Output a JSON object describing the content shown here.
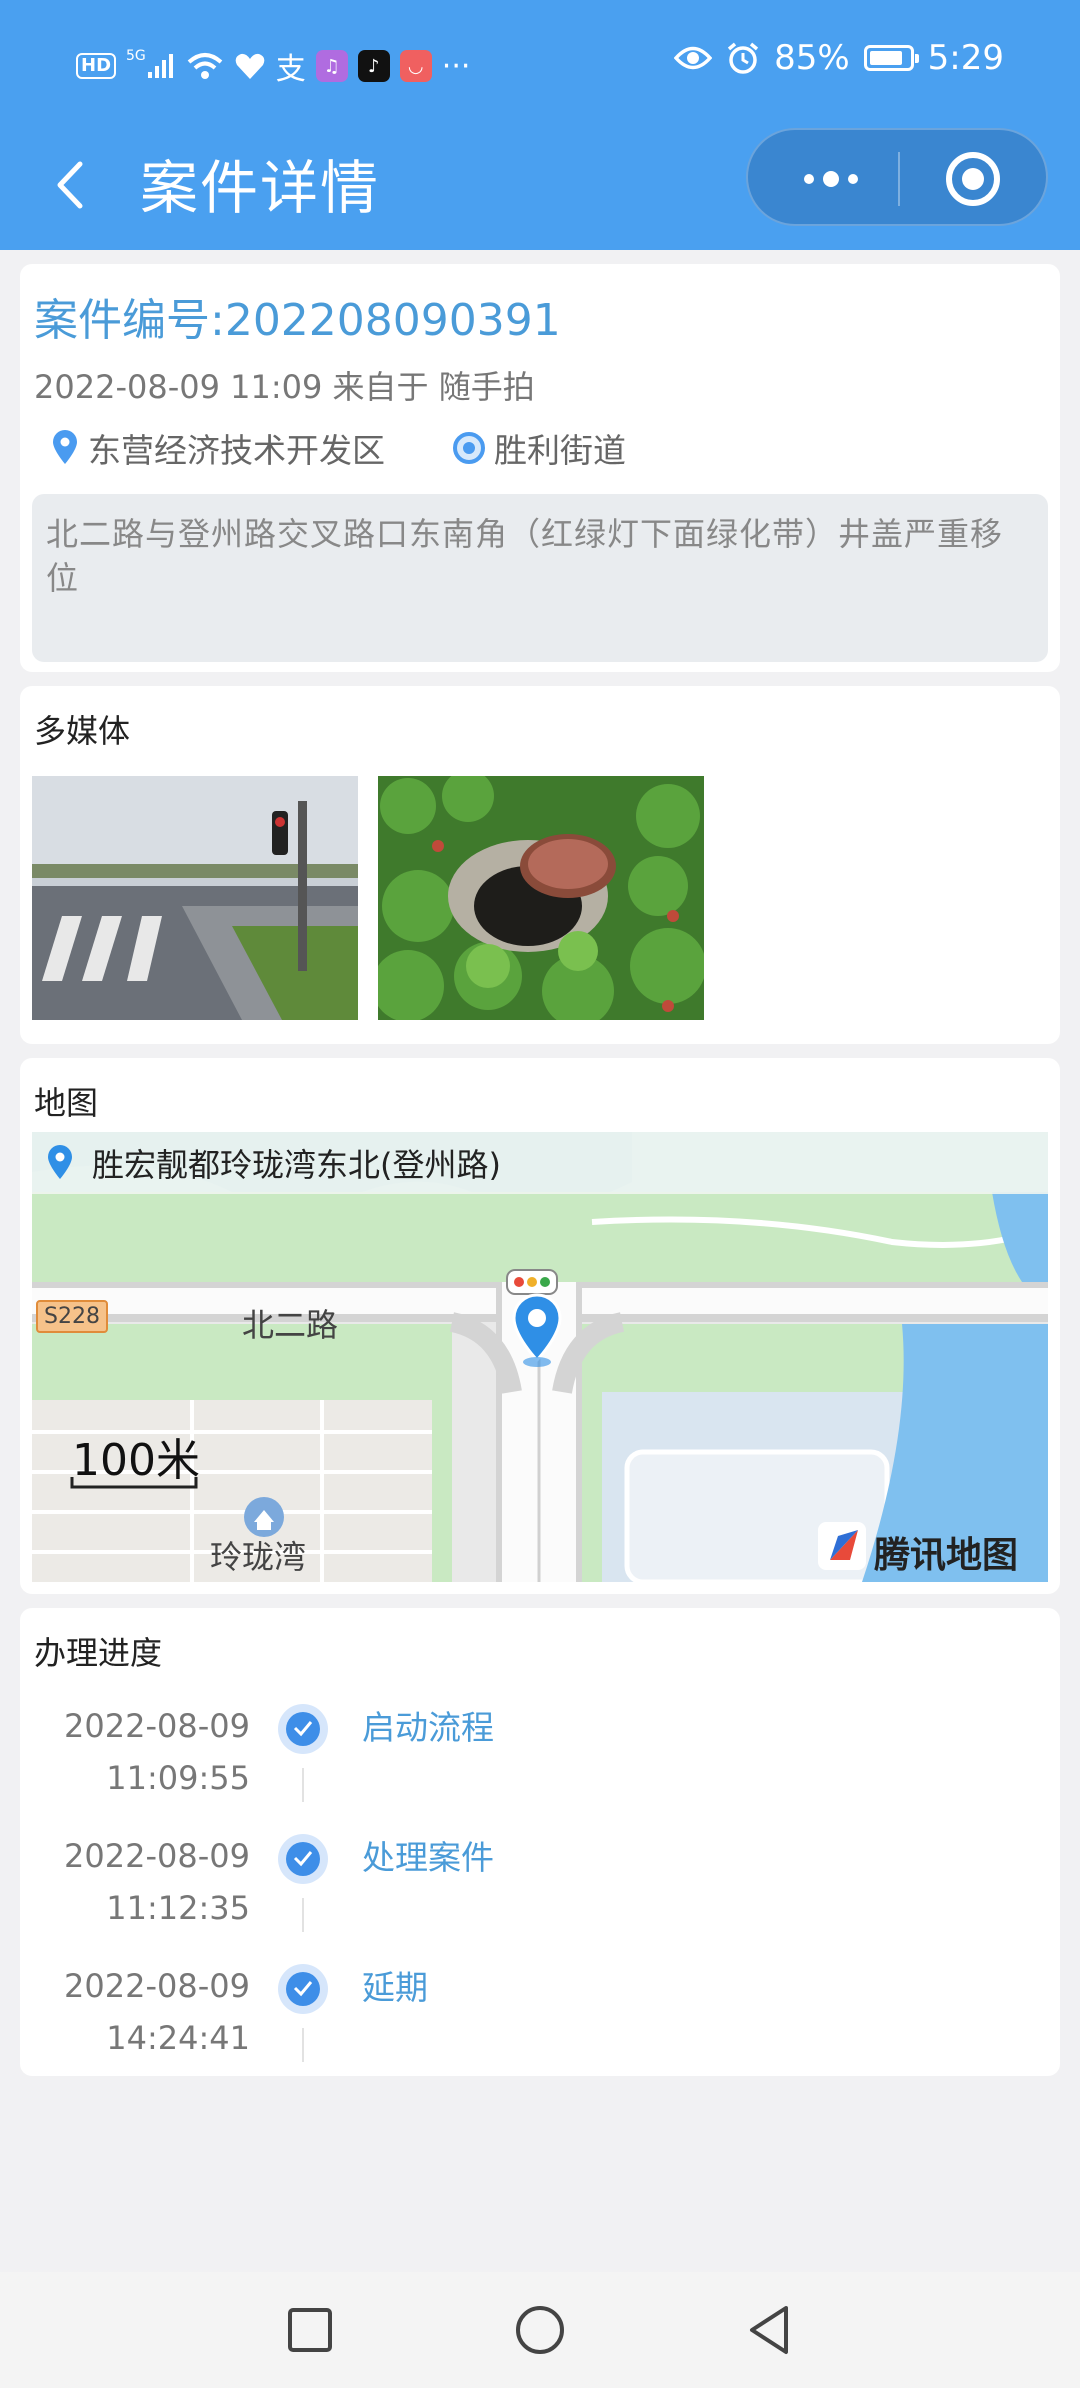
{
  "status_bar": {
    "hd": "HD",
    "network": "5G",
    "battery_pct": "85%",
    "battery_level": 0.85,
    "time": "5:29",
    "overflow": "···"
  },
  "nav": {
    "title": "案件详情"
  },
  "case": {
    "number_label": "案件编号:202208090391",
    "meta": "2022-08-09 11:09 来自于 随手拍",
    "district": "东营经济技术开发区",
    "street": "胜利街道",
    "description": "北二路与登州路交叉路口东南角（红绿灯下面绿化带）井盖严重移位"
  },
  "media": {
    "title": "多媒体"
  },
  "map": {
    "title": "地图",
    "address": "胜宏靓都玲珑湾东北(登州路)",
    "road_label": "北二路",
    "road_tag": "S228",
    "poi_label": "玲珑湾",
    "scale": "100米",
    "provider": "腾讯地图"
  },
  "progress": {
    "title": "办理进度",
    "steps": [
      {
        "date": "2022-08-09",
        "time": "11:09:55",
        "label": "启动流程"
      },
      {
        "date": "2022-08-09",
        "time": "11:12:35",
        "label": "处理案件"
      },
      {
        "date": "2022-08-09",
        "time": "14:24:41",
        "label": "延期"
      }
    ]
  },
  "colors": {
    "primary": "#4aa0f0",
    "link": "#4a9bd8",
    "background": "#f1f1f3"
  }
}
